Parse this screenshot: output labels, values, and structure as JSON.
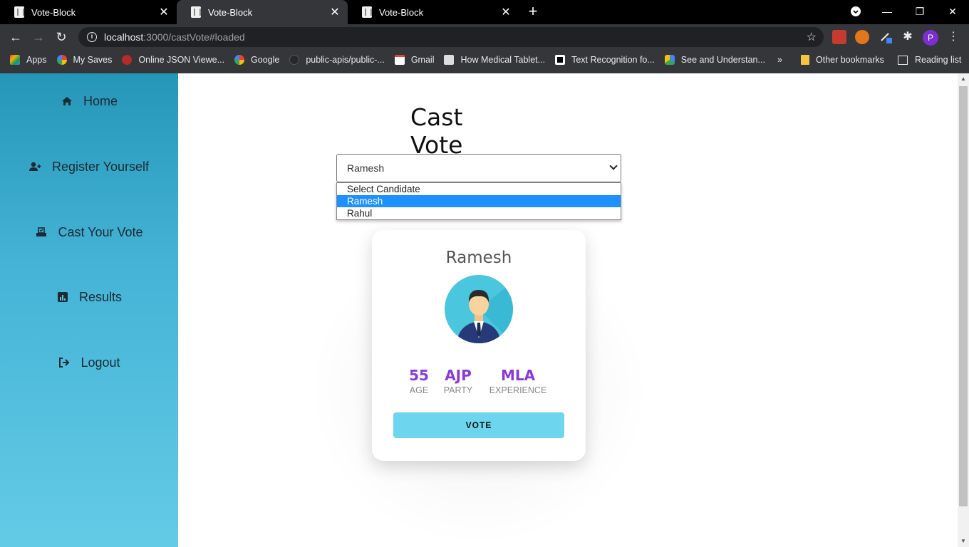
{
  "browser": {
    "tabs": [
      {
        "title": "Vote-Block",
        "active": false
      },
      {
        "title": "Vote-Block",
        "active": true
      },
      {
        "title": "Vote-Block",
        "active": false
      }
    ],
    "url_host": "localhost",
    "url_rest": ":3000/castVote#loaded",
    "bookmarks": [
      {
        "label": "Apps",
        "icon": "apps-grid-icon",
        "color": "#e8453c"
      },
      {
        "label": "My Saves",
        "icon": "google-icon",
        "color": "#ffffff"
      },
      {
        "label": "Online JSON Viewe...",
        "icon": "json-viewer-icon",
        "color": "#b52a2a"
      },
      {
        "label": "Google",
        "icon": "google-icon",
        "color": "#ffffff"
      },
      {
        "label": "public-apis/public-...",
        "icon": "github-icon",
        "color": "#24292e"
      },
      {
        "label": "Gmail",
        "icon": "gmail-icon",
        "color": "#ea4335"
      },
      {
        "label": "How Medical Tablet...",
        "icon": "site-icon",
        "color": "#dddddd"
      },
      {
        "label": "Text Recognition fo...",
        "icon": "medium-icon",
        "color": "#ffffff"
      },
      {
        "label": "See and Understan...",
        "icon": "google-cloud-icon",
        "color": "#ffffff"
      }
    ],
    "bookmarks_overflow": "»",
    "other_bookmarks": "Other bookmarks",
    "reading_list": "Reading list",
    "profile_initial": "P"
  },
  "sidebar": {
    "items": [
      {
        "label": "Home",
        "icon": "home-icon"
      },
      {
        "label": "Register Yourself",
        "icon": "user-plus-icon"
      },
      {
        "label": "Cast Your Vote",
        "icon": "vote-box-icon"
      },
      {
        "label": "Results",
        "icon": "chart-icon"
      },
      {
        "label": "Logout",
        "icon": "logout-icon"
      }
    ]
  },
  "main": {
    "title": "Cast Vote",
    "select": {
      "value": "Ramesh",
      "options": [
        "Select Candidate",
        "Ramesh",
        "Rahul"
      ],
      "highlighted": "Ramesh"
    },
    "card": {
      "name": "Ramesh",
      "stats": [
        {
          "value": "55",
          "label": "AGE"
        },
        {
          "value": "AJP",
          "label": "PARTY"
        },
        {
          "value": "MLA",
          "label": "EXPERIENCE"
        }
      ],
      "vote_label": "VOTE"
    }
  },
  "colors": {
    "accent_purple": "#8a3ad8",
    "vote_button": "#6dd5ed",
    "sidebar_top": "#2596b8",
    "sidebar_bottom": "#64cbe6",
    "option_highlight": "#1e90ff"
  }
}
